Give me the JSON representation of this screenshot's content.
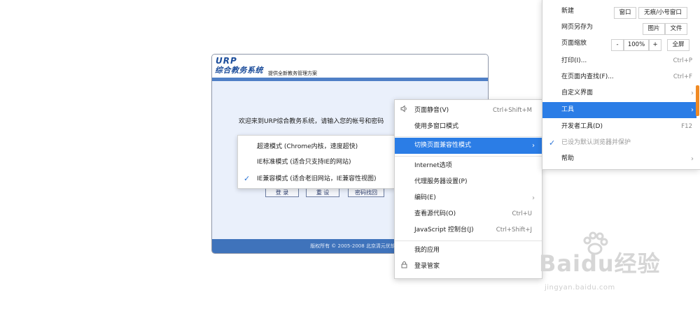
{
  "login": {
    "logo_text": "URP",
    "system_name": "综合教务系统",
    "tagline": "提供全新教务管理方案",
    "welcome": "欢迎来到URP综合教务系统，请输入您的帐号和密码",
    "buttons": [
      "登 录",
      "重 设",
      "密码找回"
    ],
    "footer": "版权所有 © 2005-2008 北京清元优软科技有限公司"
  },
  "compat_menu": {
    "items": [
      {
        "label": "超速模式 (Chrome内核，速度超快)",
        "checked": false
      },
      {
        "label": "IE标准模式 (适合只支持IE的网站)",
        "checked": false
      },
      {
        "label": "IE兼容模式 (适合老旧网站，IE兼容性视图)",
        "checked": true
      }
    ]
  },
  "tools_menu": {
    "items": [
      {
        "label": "页面静音(V)",
        "shortcut": "Ctrl+Shift+M",
        "icon": "speaker-icon"
      },
      {
        "label": "使用多窗口模式",
        "shortcut": ""
      },
      {
        "label": "切换页面兼容性模式",
        "shortcut": "",
        "submenu": true,
        "highlighted": true
      },
      {
        "label": "Internet选项",
        "shortcut": ""
      },
      {
        "label": "代理服务器设置(P)",
        "shortcut": ""
      },
      {
        "label": "编码(E)",
        "shortcut": "",
        "submenu": true
      },
      {
        "label": "查看源代码(O)",
        "shortcut": "Ctrl+U"
      },
      {
        "label": "JavaScript 控制台(J)",
        "shortcut": "Ctrl+Shift+J"
      },
      {
        "label": "我的应用",
        "shortcut": ""
      },
      {
        "label": "登录管家",
        "shortcut": "",
        "icon": "lock-icon"
      }
    ]
  },
  "main_menu": {
    "new_label": "新建",
    "new_buttons": [
      "窗口",
      "无痕/小号窗口"
    ],
    "save_label": "网页另存为",
    "save_buttons": [
      "图片",
      "文件"
    ],
    "zoom_label": "页面缩放",
    "zoom_minus": "-",
    "zoom_value": "100%",
    "zoom_plus": "+",
    "fullscreen": "全屏",
    "items": [
      {
        "label": "打印(I)...",
        "shortcut": "Ctrl+P"
      },
      {
        "label": "在页面内查找(F)...",
        "shortcut": "Ctrl+F"
      },
      {
        "label": "自定义界面",
        "shortcut": "",
        "submenu": true
      },
      {
        "label": "工具",
        "shortcut": "",
        "submenu": true,
        "highlighted": true
      },
      {
        "label": "开发者工具(D)",
        "shortcut": "F12"
      },
      {
        "label": "已设为默认浏览器并保护",
        "shortcut": "",
        "checked": true,
        "dim": true
      },
      {
        "label": "帮助",
        "shortcut": "",
        "submenu": true
      }
    ]
  },
  "watermark": {
    "brand": "Baidu经验",
    "url": "jingyan.baidu.com"
  }
}
